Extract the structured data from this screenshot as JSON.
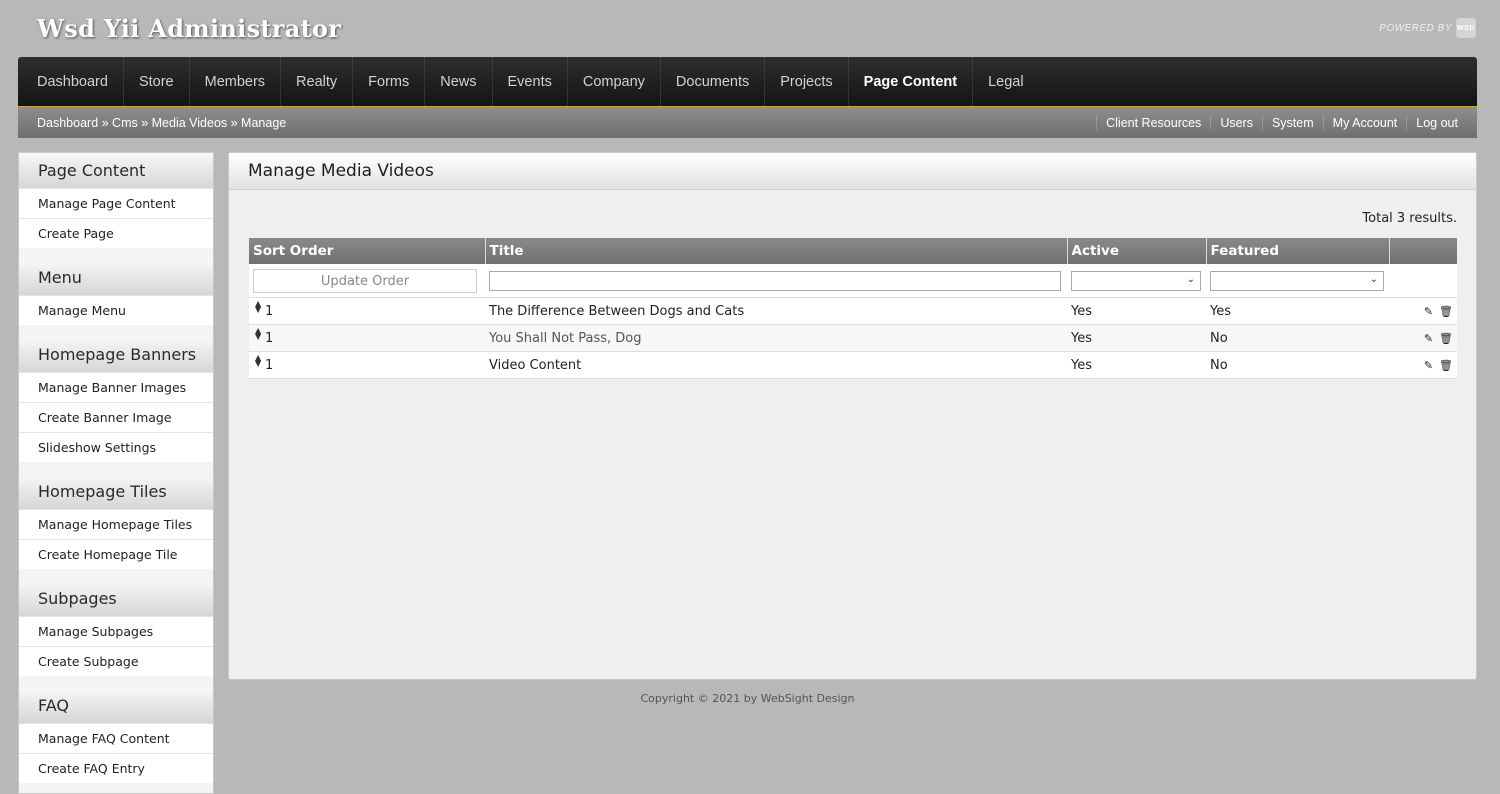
{
  "app": {
    "title": "Wsd Yii Administrator",
    "powered_by": "POWERED BY",
    "logo_text": "WSD"
  },
  "nav": {
    "items": [
      {
        "label": "Dashboard"
      },
      {
        "label": "Store"
      },
      {
        "label": "Members"
      },
      {
        "label": "Realty"
      },
      {
        "label": "Forms"
      },
      {
        "label": "News"
      },
      {
        "label": "Events"
      },
      {
        "label": "Company"
      },
      {
        "label": "Documents"
      },
      {
        "label": "Projects"
      },
      {
        "label": "Page Content"
      },
      {
        "label": "Legal"
      }
    ],
    "active": "Page Content"
  },
  "breadcrumb": "Dashboard » Cms » Media Videos » Manage",
  "userlinks": [
    "Client Resources",
    "Users",
    "System",
    "My Account",
    "Log out"
  ],
  "sidebar": {
    "sections": [
      {
        "title": "Page Content",
        "items": [
          "Manage Page Content",
          "Create Page"
        ]
      },
      {
        "title": "Menu",
        "items": [
          "Manage Menu"
        ]
      },
      {
        "title": "Homepage Banners",
        "items": [
          "Manage Banner Images",
          "Create Banner Image",
          "Slideshow Settings"
        ]
      },
      {
        "title": "Homepage Tiles",
        "items": [
          "Manage Homepage Tiles",
          "Create Homepage Tile"
        ]
      },
      {
        "title": "Subpages",
        "items": [
          "Manage Subpages",
          "Create Subpage"
        ]
      },
      {
        "title": "FAQ",
        "items": [
          "Manage FAQ Content",
          "Create FAQ Entry"
        ]
      }
    ]
  },
  "main": {
    "title": "Manage Media Videos",
    "summary": "Total 3 results.",
    "update_order_label": "Update Order",
    "columns": [
      "Sort Order",
      "Title",
      "Active",
      "Featured"
    ],
    "rows": [
      {
        "sort": "1",
        "title": "The Difference Between Dogs and Cats",
        "active": "Yes",
        "featured": "Yes"
      },
      {
        "sort": "1",
        "title": "You Shall Not Pass, Dog",
        "active": "Yes",
        "featured": "No"
      },
      {
        "sort": "1",
        "title": "Video Content",
        "active": "Yes",
        "featured": "No"
      }
    ]
  },
  "footer": "Copyright © 2021 by WebSight Design",
  "colors": {
    "nav_bg": "#1c1c1c",
    "accent_line": "#c9a440",
    "body_bg": "#b8b8b8"
  }
}
